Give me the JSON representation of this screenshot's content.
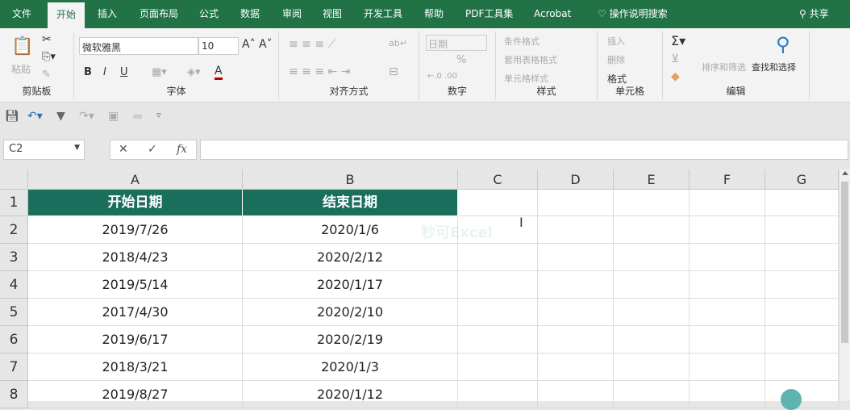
{
  "tabs": [
    "文件",
    "开始",
    "插入",
    "页面布局",
    "公式",
    "数据",
    "审阅",
    "视图",
    "开发工具",
    "帮助",
    "PDF工具集",
    "Acrobat"
  ],
  "tell_me": "操作说明搜索",
  "share": "共享",
  "ribbon": {
    "clipboard": {
      "paste": "粘贴",
      "label": "剪贴板"
    },
    "font": {
      "name": "微软雅黑",
      "size": "10",
      "bold": "B",
      "italic": "I",
      "underline": "U",
      "label": "字体"
    },
    "alignment": {
      "label": "对齐方式"
    },
    "number": {
      "format": "日期",
      "percent": "%",
      "label": "数字"
    },
    "styles": {
      "conditional": "条件格式",
      "table": "套用表格格式",
      "cell": "单元格样式",
      "label": "样式"
    },
    "cells": {
      "insert": "插入",
      "delete": "删除",
      "format": "格式",
      "label": "单元格"
    },
    "editing": {
      "sort": "排序和筛选",
      "find": "查找和选择",
      "label": "编辑"
    }
  },
  "namebox": "C2",
  "formula": "",
  "columns": [
    "A",
    "B",
    "C",
    "D",
    "E",
    "F",
    "G"
  ],
  "rows": [
    "1",
    "2",
    "3",
    "4",
    "5",
    "6",
    "7",
    "8"
  ],
  "headers": [
    "开始日期",
    "结束日期"
  ],
  "data": [
    [
      "2019/7/26",
      "2020/1/6"
    ],
    [
      "2018/4/23",
      "2020/2/12"
    ],
    [
      "2019/5/14",
      "2020/1/17"
    ],
    [
      "2017/4/30",
      "2020/2/10"
    ],
    [
      "2019/6/17",
      "2020/2/19"
    ],
    [
      "2018/3/21",
      "2020/1/3"
    ],
    [
      "2019/8/27",
      "2020/1/12"
    ]
  ],
  "watermark": "秒可Excel"
}
